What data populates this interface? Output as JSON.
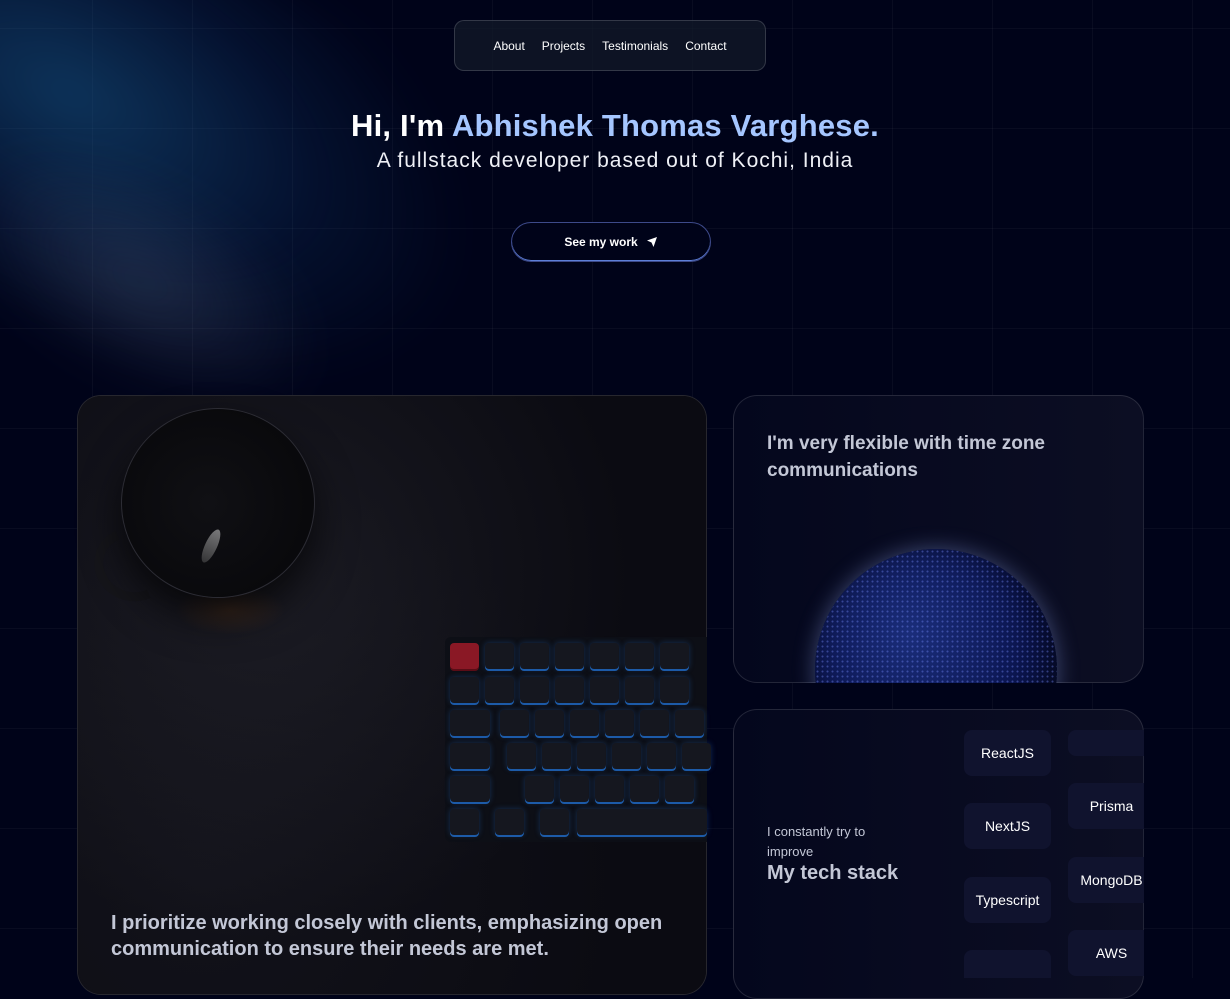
{
  "nav": {
    "items": [
      {
        "label": "About"
      },
      {
        "label": "Projects"
      },
      {
        "label": "Testimonials"
      },
      {
        "label": "Contact"
      }
    ]
  },
  "hero": {
    "greeting": "Hi, I'm ",
    "name": "Abhishek Thomas Varghese.",
    "subtitle": "A fullstack developer based out of Kochi, India",
    "cta_label": "See my work",
    "cta_icon": "send-arrow-icon"
  },
  "cards": {
    "collaboration": {
      "text": "I prioritize working closely with clients, emphasizing open communication to ensure their needs are met."
    },
    "timezone": {
      "text": "I'm very flexible with time zone communications"
    },
    "tech_stack": {
      "small_text": "I constantly try to improve",
      "title": "My tech stack",
      "column_one": [
        "",
        "ReactJS",
        "NextJS",
        "Typescript",
        ""
      ],
      "column_two": [
        "",
        "Prisma",
        "MongoDB",
        "AWS"
      ]
    }
  },
  "colors": {
    "background": "#000319",
    "accent": "#a5c6ff",
    "card_text": "#c3c7d6",
    "chip_bg": "#10132e"
  }
}
